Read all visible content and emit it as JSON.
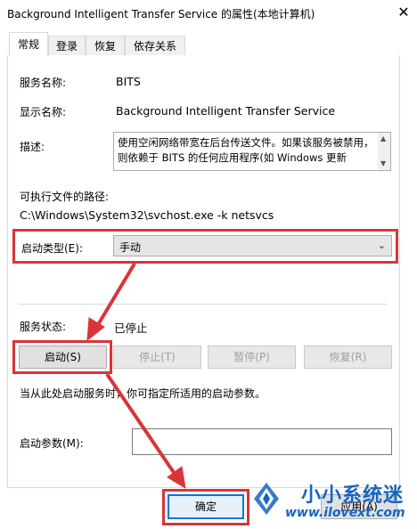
{
  "window": {
    "title": "Background Intelligent Transfer Service 的属性(本地计算机)",
    "close_icon": "close-icon"
  },
  "tabs": [
    {
      "label": "常规",
      "active": true
    },
    {
      "label": "登录",
      "active": false
    },
    {
      "label": "恢复",
      "active": false
    },
    {
      "label": "依存关系",
      "active": false
    }
  ],
  "general": {
    "service_name_label": "服务名称:",
    "service_name_value": "BITS",
    "display_name_label": "显示名称:",
    "display_name_value": "Background Intelligent Transfer Service",
    "description_label": "描述:",
    "description_value": "使用空闲网络带宽在后台传送文件。如果该服务被禁用，则依赖于 BITS 的任何应用程序(如 Windows 更新",
    "exe_path_label": "可执行文件的路径:",
    "exe_path_value": "C:\\Windows\\System32\\svchost.exe -k netsvcs",
    "startup_type_label": "启动类型(E):",
    "startup_type_value": "手动",
    "service_status_label": "服务状态:",
    "service_status_value": "已停止",
    "buttons": {
      "start": "启动(S)",
      "stop": "停止(T)",
      "pause": "暂停(P)",
      "resume": "恢复(R)"
    },
    "hint": "当从此处启动服务时，你可指定所适用的启动参数。",
    "start_params_label": "启动参数(M):",
    "start_params_value": ""
  },
  "footer": {
    "ok": "确定",
    "apply_partial": "应用(A)"
  },
  "watermark": {
    "main": "小小系统迷",
    "url": "www.ilovext.com"
  },
  "colors": {
    "highlight_red": "#d9343a",
    "accent_blue": "#0078d7",
    "watermark_blue": "#1565c0"
  }
}
